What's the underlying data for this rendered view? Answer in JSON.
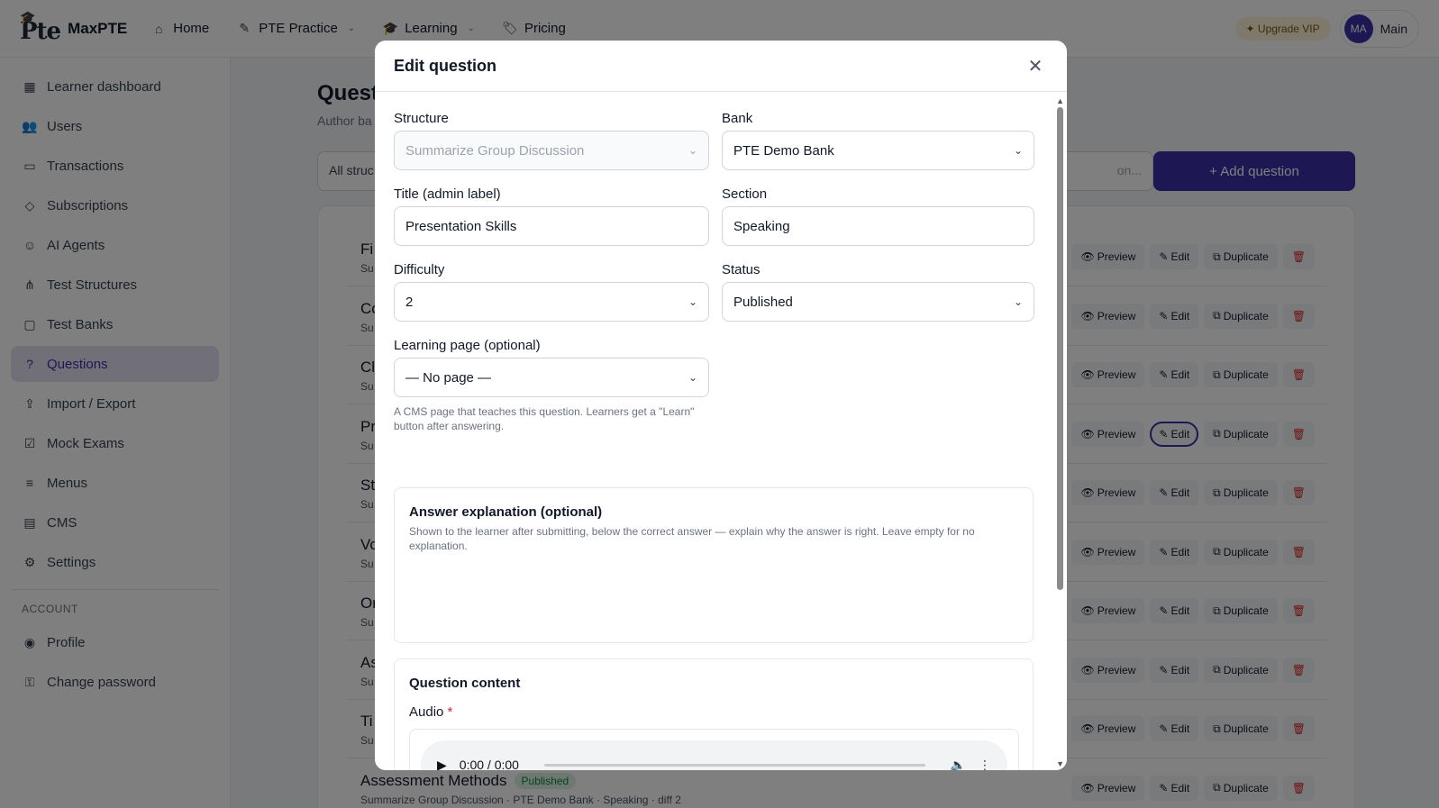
{
  "topnav": {
    "logo_mark": "Pte",
    "brand": "MaxPTE",
    "items": [
      {
        "label": "Home"
      },
      {
        "label": "PTE Practice"
      },
      {
        "label": "Learning"
      },
      {
        "label": "Pricing"
      }
    ],
    "upgrade_label": "✦ Upgrade VIP",
    "avatar_initials": "MA",
    "user_name": "Main"
  },
  "sidebar": {
    "items": [
      {
        "label": "Learner dashboard"
      },
      {
        "label": "Users"
      },
      {
        "label": "Transactions"
      },
      {
        "label": "Subscriptions"
      },
      {
        "label": "AI Agents"
      },
      {
        "label": "Test Structures"
      },
      {
        "label": "Test Banks"
      },
      {
        "label": "Questions"
      },
      {
        "label": "Import / Export"
      },
      {
        "label": "Mock Exams"
      },
      {
        "label": "Menus"
      },
      {
        "label": "CMS"
      },
      {
        "label": "Settings"
      }
    ],
    "active_index": 7,
    "account_heading": "ACCOUNT",
    "account_items": [
      {
        "label": "Profile"
      },
      {
        "label": "Change password"
      }
    ]
  },
  "page": {
    "title": "Quest",
    "subtitle": "Author ba",
    "filter_label": "All struc",
    "search_placeholder": "on...",
    "add_button": "+ Add question",
    "rows": [
      {
        "title": "Fi",
        "meta": "Su"
      },
      {
        "title": "Co",
        "meta": "Su"
      },
      {
        "title": "Cl",
        "meta": "Su"
      },
      {
        "title": "Pr",
        "meta": "Su"
      },
      {
        "title": "St",
        "meta": "Su"
      },
      {
        "title": "Vo",
        "meta": "Su"
      },
      {
        "title": "Or",
        "meta": "Su"
      },
      {
        "title": "As",
        "meta": "Su"
      },
      {
        "title": "Ti",
        "meta": "Su"
      },
      {
        "title": "Assessment Methods",
        "badge": "Published",
        "meta": "Summarize Group Discussion · PTE Demo Bank · Speaking · diff 2"
      }
    ],
    "actions": {
      "preview": "Preview",
      "edit": "Edit",
      "duplicate": "Duplicate",
      "delete": "🗑"
    },
    "focused_edit_row": 3
  },
  "modal": {
    "title": "Edit question",
    "structure": {
      "label": "Structure",
      "value": "Summarize Group Discussion"
    },
    "bank": {
      "label": "Bank",
      "value": "PTE Demo Bank"
    },
    "title_field": {
      "label": "Title (admin label)",
      "value": "Presentation Skills"
    },
    "section": {
      "label": "Section",
      "value": "Speaking"
    },
    "difficulty": {
      "label": "Difficulty",
      "value": "2"
    },
    "status": {
      "label": "Status",
      "value": "Published"
    },
    "learning_page": {
      "label": "Learning page (optional)",
      "value": "— No page —",
      "helper": "A CMS page that teaches this question. Learners get a \"Learn\" button after answering."
    },
    "explanation": {
      "title": "Answer explanation (optional)",
      "description": "Shown to the learner after submitting, below the correct answer — explain why the answer is right. Leave empty for no explanation."
    },
    "content": {
      "title": "Question content",
      "audio_label": "Audio",
      "required_mark": "*",
      "audio_time": "0:00 / 0:00"
    }
  }
}
